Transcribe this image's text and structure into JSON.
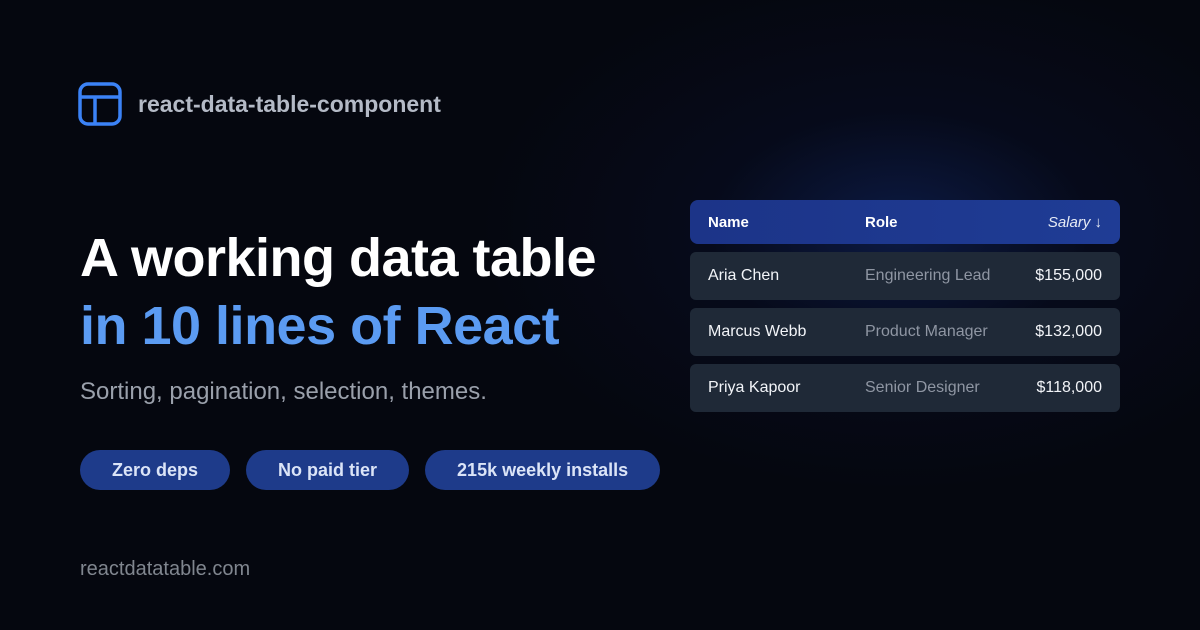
{
  "brand": {
    "name": "react-data-table-component",
    "icon": "table-layout-icon",
    "accent_color": "#3b82f6"
  },
  "headline": {
    "line1": "A working data table",
    "line2": "in 10 lines of React",
    "line2_color": "#5b9bf2"
  },
  "subtitle": "Sorting, pagination, selection, themes.",
  "pills": [
    {
      "label": "Zero deps"
    },
    {
      "label": "No paid tier"
    },
    {
      "label": "215k weekly installs"
    }
  ],
  "footer": {
    "url": "reactdatatable.com"
  },
  "table": {
    "headers": {
      "name": "Name",
      "role": "Role",
      "salary": "Salary ↓"
    },
    "sort_icon": "arrow-down-icon",
    "rows": [
      {
        "name": "Aria Chen",
        "role": "Engineering Lead",
        "salary": "$155,000"
      },
      {
        "name": "Marcus Webb",
        "role": "Product Manager",
        "salary": "$132,000"
      },
      {
        "name": "Priya Kapoor",
        "role": "Senior Designer",
        "salary": "$118,000"
      }
    ]
  }
}
